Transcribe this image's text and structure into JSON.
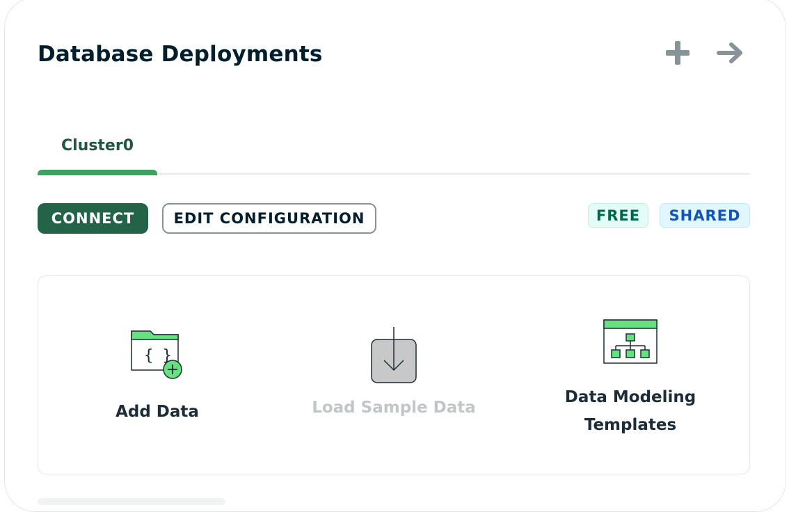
{
  "header": {
    "title": "Database Deployments",
    "add_icon": "plus-icon",
    "go_icon": "arrow-right-icon"
  },
  "tabs": [
    {
      "label": "Cluster0",
      "active": true
    }
  ],
  "actions": {
    "connect_label": "CONNECT",
    "edit_label": "EDIT CONFIGURATION"
  },
  "badges": {
    "free": "FREE",
    "shared": "SHARED"
  },
  "quick_actions": [
    {
      "label": "Add Data",
      "icon": "folder-add-icon",
      "disabled": false
    },
    {
      "label": "Load Sample Data",
      "icon": "download-icon",
      "disabled": true
    },
    {
      "label_line1": "Data Modeling",
      "label_line2": "Templates",
      "icon": "hierarchy-template-icon",
      "disabled": false
    }
  ],
  "colors": {
    "brand_green": "#236448",
    "tab_active": "#3da25d",
    "icon_green": "#68e07f",
    "free_text": "#00684a",
    "shared_text": "#1254b7"
  }
}
